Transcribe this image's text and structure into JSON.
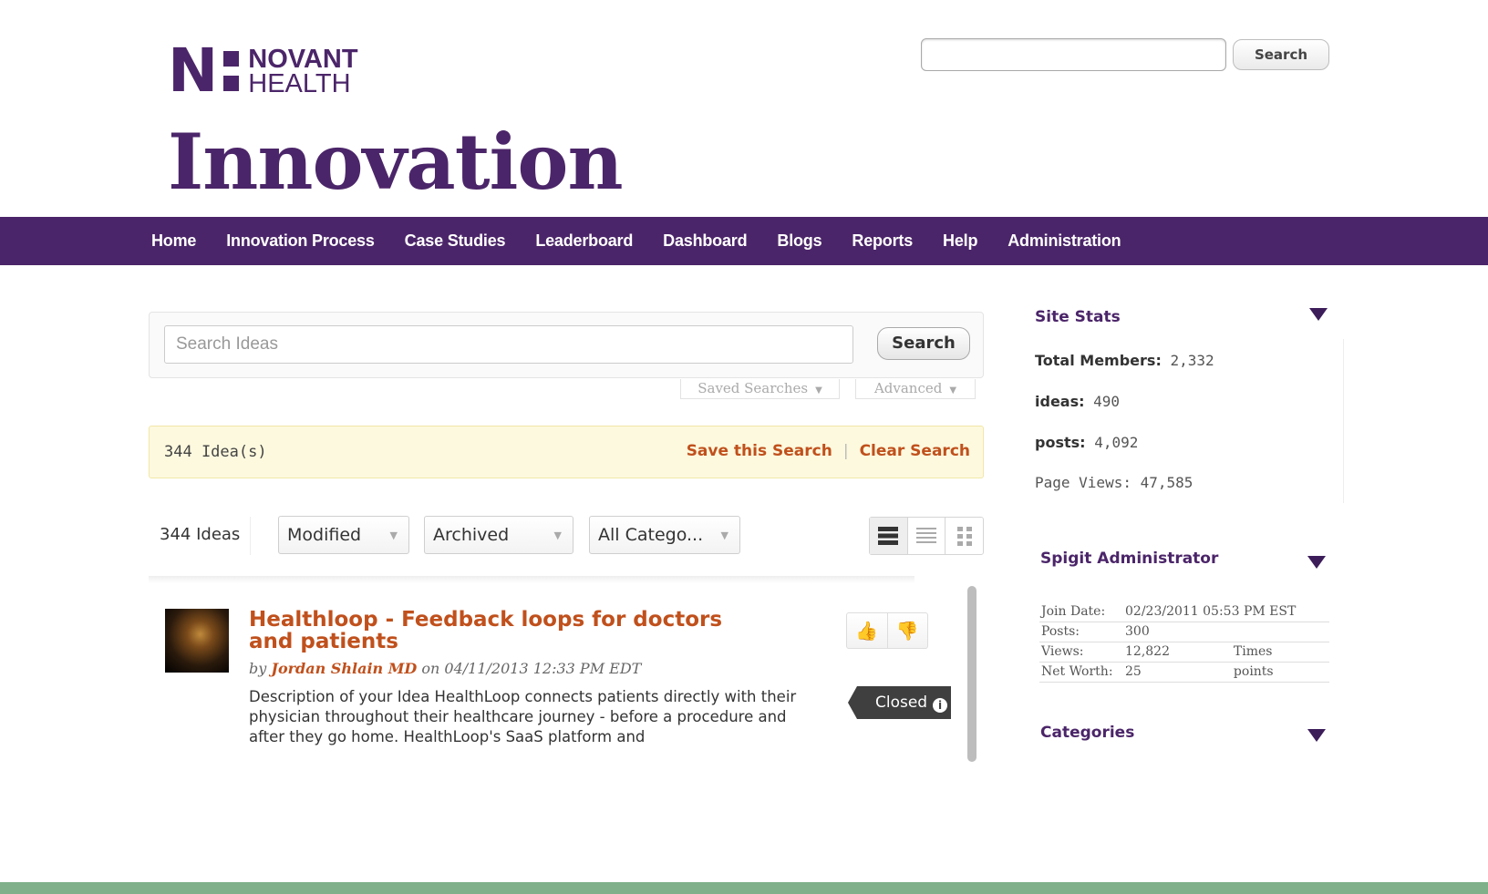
{
  "header": {
    "logo_mark": "N",
    "logo_line1": "NOVANT",
    "logo_line2": "HEALTH",
    "title": "Innovation",
    "search_placeholder": "",
    "search_button": "Search"
  },
  "nav": {
    "items": [
      {
        "label": "Home"
      },
      {
        "label": "Innovation Process"
      },
      {
        "label": "Case Studies"
      },
      {
        "label": "Leaderboard"
      },
      {
        "label": "Dashboard"
      },
      {
        "label": "Blogs"
      },
      {
        "label": "Reports"
      },
      {
        "label": "Help"
      },
      {
        "label": "Administration"
      }
    ],
    "bg_color": "#4b2569"
  },
  "search_panel": {
    "placeholder": "Search Ideas",
    "button": "Search",
    "saved_searches": "Saved Searches",
    "advanced": "Advanced"
  },
  "results": {
    "count_text": "344 Idea(s)",
    "save_link": "Save this Search",
    "separator": "|",
    "clear_link": "Clear Search",
    "link_color": "#c0501c"
  },
  "toolbar": {
    "ideas_count": "344 Ideas",
    "sort_select": "Modified",
    "status_select": "Archived",
    "category_select": "All Catego...",
    "view_modes": [
      "view-large-list-icon",
      "view-compact-list-icon",
      "view-grid-icon"
    ]
  },
  "idea": {
    "title": "Healthloop - Feedback loops for doctors and patients",
    "by": "by",
    "author": "Jordan Shlain MD",
    "on_date": "on 04/11/2013 12:33 PM EDT",
    "description": "Description of your Idea HealthLoop connects patients directly with their physician throughout their healthcare journey - before a procedure and after they go home. HealthLoop's SaaS platform and",
    "status": "Closed",
    "status_info": "i"
  },
  "sidebar": {
    "site_stats": {
      "heading": "Site Stats",
      "stats": [
        {
          "label": "Total Members:",
          "value": "2,332"
        },
        {
          "label": "ideas:",
          "value": "490"
        },
        {
          "label": "posts:",
          "value": "4,092"
        },
        {
          "label": "Page Views:",
          "value": "47,585"
        }
      ]
    },
    "admin": {
      "heading": "Spigit Administrator",
      "rows": [
        {
          "key": "Join Date:",
          "value": "02/23/2011 05:53 PM EST",
          "unit": ""
        },
        {
          "key": "Posts:",
          "value": "300",
          "unit": ""
        },
        {
          "key": "Views:",
          "value": "12,822",
          "unit": "Times"
        },
        {
          "key": "Net Worth:",
          "value": "25",
          "unit": "points"
        }
      ]
    },
    "categories": {
      "heading": "Categories"
    }
  },
  "footer": {
    "color": "#7fb08a"
  }
}
